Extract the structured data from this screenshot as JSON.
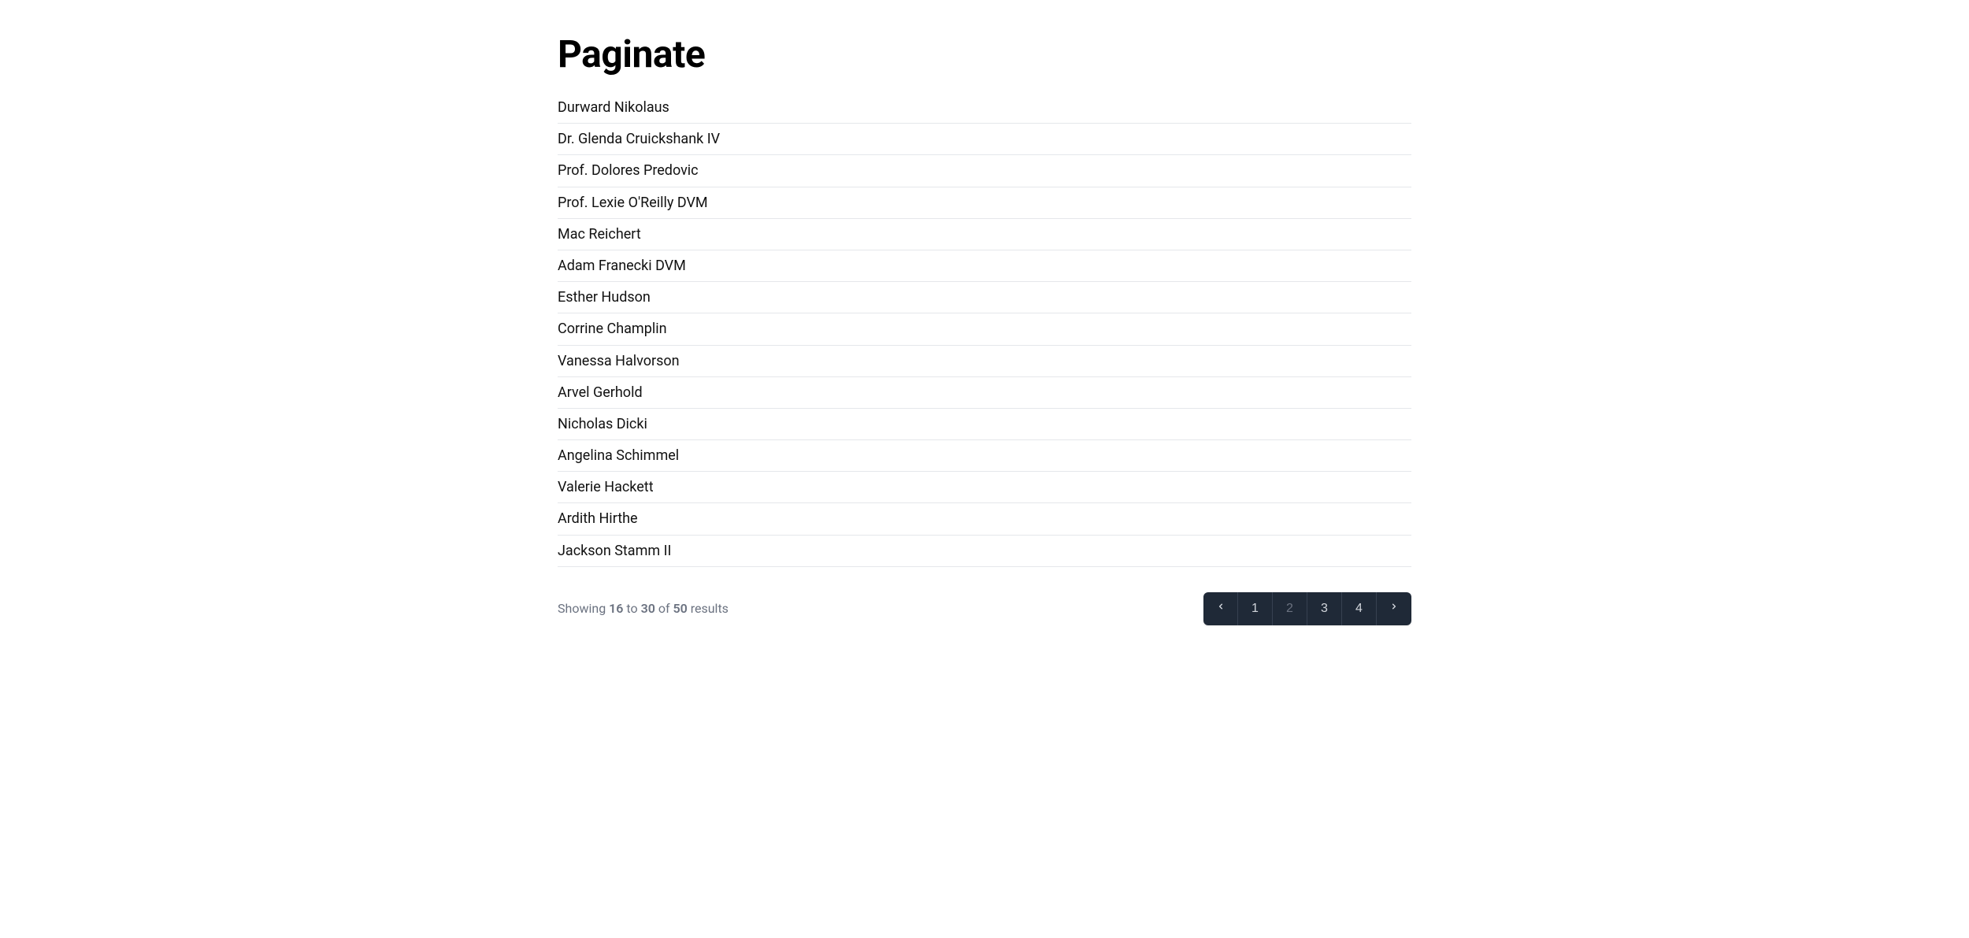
{
  "header": {
    "title": "Paginate"
  },
  "users": [
    "Durward Nikolaus",
    "Dr. Glenda Cruickshank IV",
    "Prof. Dolores Predovic",
    "Prof. Lexie O'Reilly DVM",
    "Mac Reichert",
    "Adam Franecki DVM",
    "Esther Hudson",
    "Corrine Champlin",
    "Vanessa Halvorson",
    "Arvel Gerhold",
    "Nicholas Dicki",
    "Angelina Schimmel",
    "Valerie Hackett",
    "Ardith Hirthe",
    "Jackson Stamm II"
  ],
  "pagination": {
    "showing_prefix": "Showing ",
    "from": "16",
    "to_word": " to ",
    "to": "30",
    "of_word": " of ",
    "total": "50",
    "results_word": " results",
    "pages": [
      "1",
      "2",
      "3",
      "4"
    ],
    "current_page": "2"
  }
}
